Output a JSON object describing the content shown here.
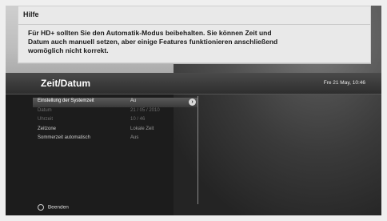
{
  "help": {
    "title": "Hilfe",
    "lines": [
      "Für HD+ sollten Sie den Automatik-Modus beibehalten. Sie können Zeit und",
      "Datum auch manuell setzen, aber einige Features funktionieren anschließend",
      "womöglich nicht korrekt."
    ]
  },
  "header": {
    "title": "Zeit/Datum",
    "datetime": "Fre 21 May, 10:46"
  },
  "settings": [
    {
      "label": "Einstellung der Systemzeit",
      "value": "Au"
    },
    {
      "label": "Datum",
      "value": "21 / 05 / 2010"
    },
    {
      "label": "Uhrzeit",
      "value": "10 / 46"
    },
    {
      "label": "Zeitzone",
      "value": "Lokale Zeit"
    },
    {
      "label": "Sommerzeit automatisch",
      "value": "Aus"
    }
  ],
  "chevron_glyph": "›",
  "footer": {
    "exit_label": "Beenden"
  }
}
